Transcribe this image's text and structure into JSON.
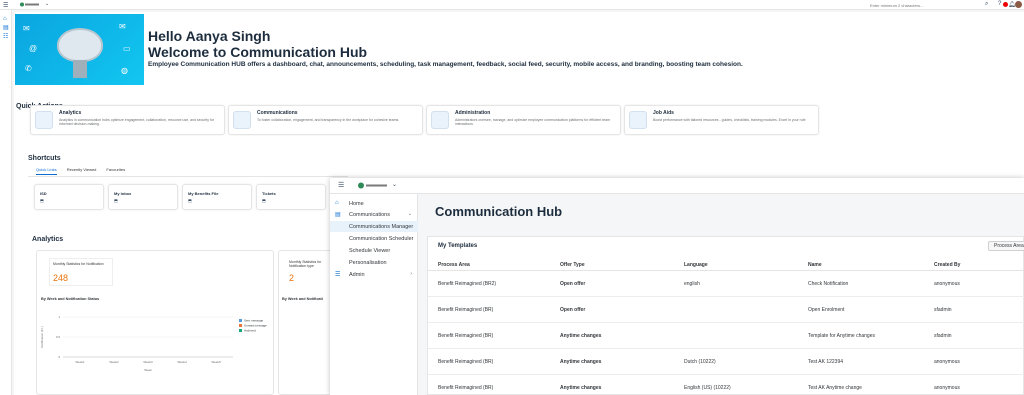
{
  "topbar": {
    "search_placeholder": "Enter minimum 2 characters..."
  },
  "banner": {
    "hello": "Hello Aanya Singh",
    "welcome": "Welcome to Communication Hub",
    "tagline": "Employee Communication HUB offers a dashboard, chat, announcements, scheduling, task management, feedback, social feed, security, mobile access, and branding, boosting team cohesion."
  },
  "quick_actions": {
    "title": "Quick Actions",
    "cards": [
      {
        "title": "Analytics",
        "desc": "Analytics in communication hubs optimize engagement, collaboration, resource use, and security for informed decision-making."
      },
      {
        "title": "Communications",
        "desc": "To foster collaboration, engagement, and transparency in the workplace for cohesive teams."
      },
      {
        "title": "Administration",
        "desc": "Administrators oversee, manage, and optimize employee communication platforms for efficient team interactions."
      },
      {
        "title": "Job Aids",
        "desc": "Boost performance with tailored resources - guides, checklists, training modules. Excel in your role"
      }
    ]
  },
  "shortcuts": {
    "title": "Shortcuts",
    "tabs": [
      "Quick Links",
      "Recently Viewed",
      "Favourites"
    ],
    "items": [
      "ISD",
      "My Inbox",
      "My Benefits File",
      "Tickets"
    ]
  },
  "analytics": {
    "title": "Analytics",
    "card1": {
      "kpi_title": "Monthly Statistics for Notification",
      "kpi_value": "248",
      "chart_title": "By Week and Notification Status"
    },
    "card2": {
      "kpi_title": "Monthly Statistics for Notification type",
      "kpi_value": "2",
      "chart_title": "By Week and Notificati"
    }
  },
  "chart_data": {
    "type": "bar",
    "title": "By Week and Notification Status",
    "categories": [
      "Week1",
      "Week2",
      "Week3",
      "Week4",
      "Week5"
    ],
    "ylabel": "Notification (Ct.)",
    "xlabel": "Week",
    "ylim": [
      0,
      1
    ],
    "yticks": [
      "1",
      "0.5",
      "0"
    ],
    "legend": "right",
    "series": [
      {
        "name": "Sent message",
        "color": "#5899da",
        "values": [
          0,
          0,
          0,
          0,
          0
        ]
      },
      {
        "name": "Unread message",
        "color": "#e8743b",
        "values": [
          0,
          0,
          0,
          0,
          0
        ]
      },
      {
        "name": "Archived",
        "color": "#19a979",
        "values": [
          0,
          0,
          0,
          0,
          0
        ]
      }
    ]
  },
  "overlay": {
    "nav": [
      {
        "label": "Home",
        "icon": "⌂"
      },
      {
        "label": "Communications",
        "icon": "▤",
        "chevron": "⌄"
      },
      {
        "label": "Communications Manager",
        "icon": ""
      },
      {
        "label": "Communication Scheduler",
        "icon": ""
      },
      {
        "label": "Schedule Viewer",
        "icon": ""
      },
      {
        "label": "Personalisation",
        "icon": ""
      },
      {
        "label": "Admin",
        "icon": "☰",
        "chevron": "›"
      }
    ],
    "hub_title": "Communication Hub",
    "templates": {
      "title": "My Templates",
      "button": "Process Area",
      "columns": [
        "Process Area",
        "Offer Type",
        "Language",
        "Name",
        "Created By"
      ],
      "rows": [
        [
          "Benefit Reimagined (BR2)",
          "Open offer",
          "english",
          "Check Notification",
          "anonymous"
        ],
        [
          "Benefit Reimagined (BR)",
          "Open offer",
          "",
          "Open Enrolment",
          "sfadmin"
        ],
        [
          "Benefit Reimagined (BR)",
          "Anytime changes",
          "",
          "Template for Anytime changes",
          "sfadmin"
        ],
        [
          "Benefit Reimagined (BR)",
          "Anytime changes",
          "Dutch (10222)",
          "Test AK 122394",
          "anonymous"
        ],
        [
          "Benefit Reimagined (BR)",
          "Anytime changes",
          "English (US) (10222)",
          "Test AK Anytime change",
          "anonymous"
        ]
      ]
    }
  }
}
